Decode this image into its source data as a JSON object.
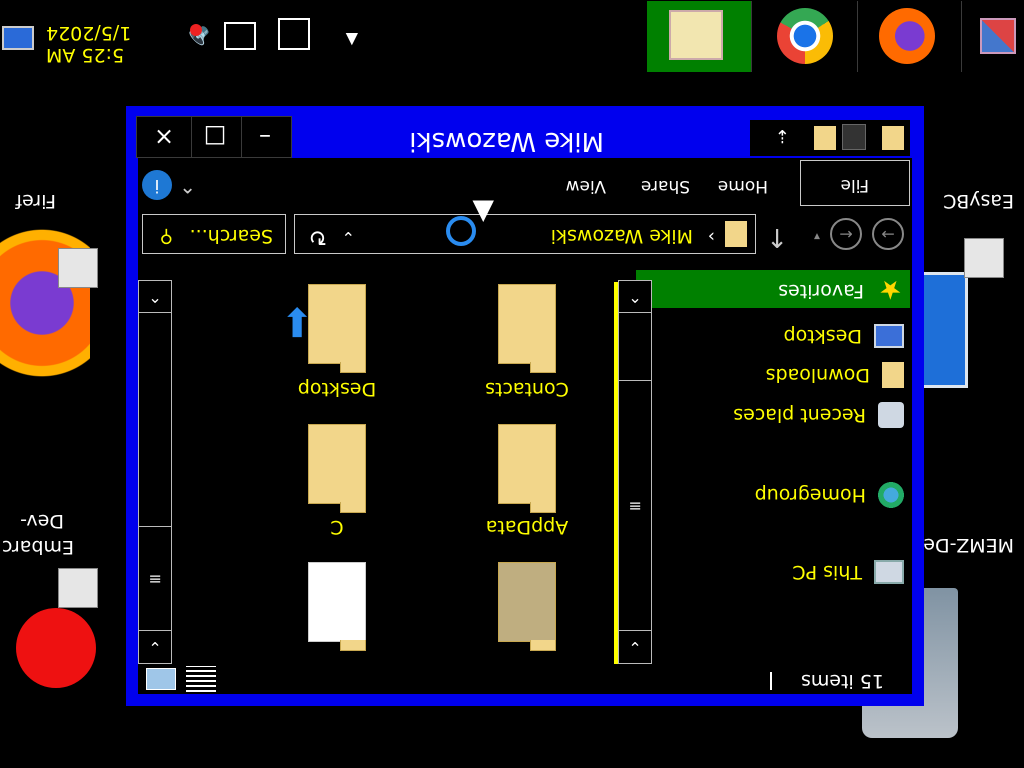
{
  "taskbar": {
    "time": "5:25 AM",
    "date": "1/5/2024",
    "tray_overflow_icon": "chevron-up-icon",
    "apps": [
      {
        "name": "file-explorer-icon",
        "active": true
      },
      {
        "name": "chrome-icon",
        "active": false
      },
      {
        "name": "firefox-icon",
        "active": false
      },
      {
        "name": "app-grid-icon",
        "active": false
      }
    ]
  },
  "desktop": {
    "icons": [
      {
        "label": "MEMZ-Des"
      },
      {
        "label": "Embarc"
      },
      {
        "label": "Dev-"
      },
      {
        "label": "EasyBC"
      },
      {
        "label": "Firef"
      }
    ]
  },
  "window": {
    "title": "Mike Wazowski",
    "buttons": {
      "minimize": "–",
      "maximize": "□",
      "close": "×"
    },
    "ribbon_tabs": [
      "File",
      "Home",
      "Share",
      "View"
    ],
    "address": {
      "path": "Mike Wazowski",
      "separator": "›"
    },
    "search": {
      "placeholder": "Search...",
      "icon": "search-icon"
    },
    "nav": {
      "items": [
        {
          "label": "Favorites",
          "selected": true
        },
        {
          "label": "Desktop"
        },
        {
          "label": "Downloads"
        },
        {
          "label": "Recent places"
        },
        {
          "label": "Homegroup"
        },
        {
          "label": "This PC"
        }
      ]
    },
    "files": [
      {
        "label": "AppData"
      },
      {
        "label": "C"
      },
      {
        "label": "Contacts"
      },
      {
        "label": "Desktop"
      }
    ],
    "status": {
      "count": "15 items"
    }
  },
  "colors": {
    "window_border": "#0000ee",
    "selection": "#008000",
    "text_accent": "#ffff00"
  }
}
